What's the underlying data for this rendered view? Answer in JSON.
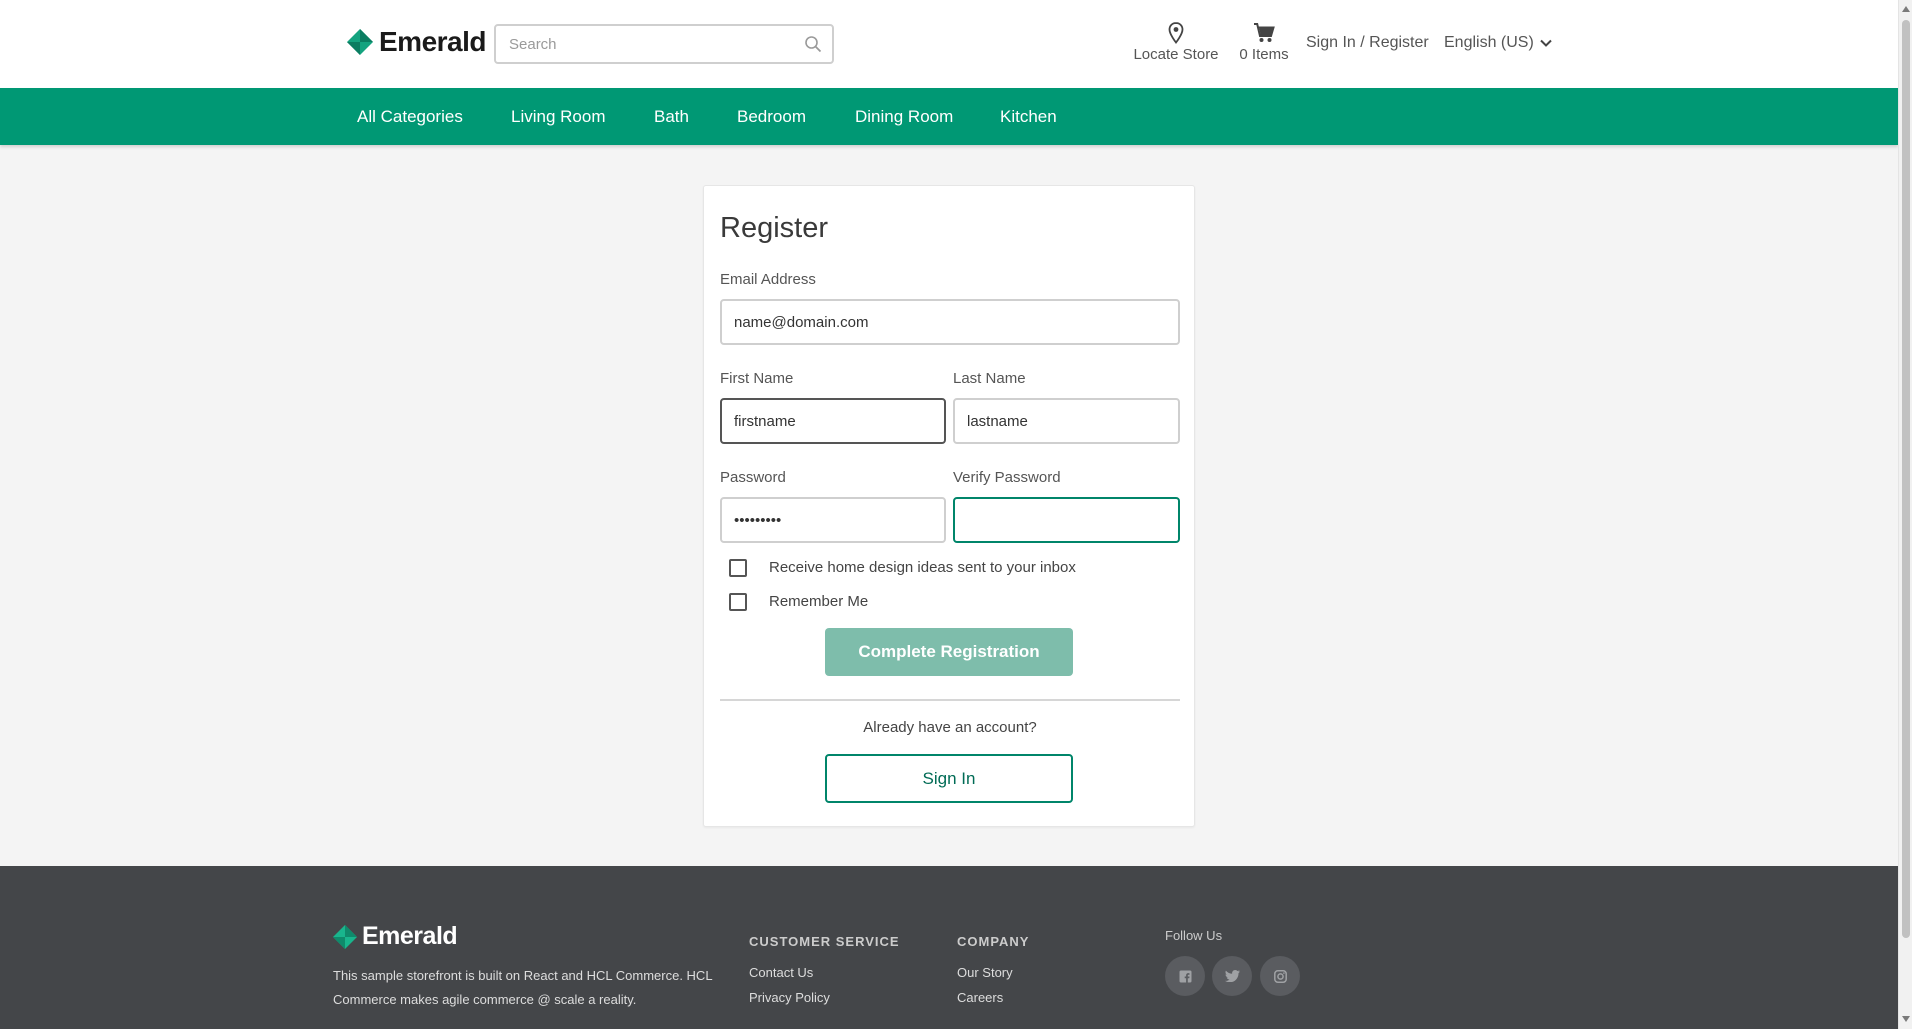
{
  "header": {
    "brand": "Emerald",
    "search_placeholder": "Search",
    "locate_store": "Locate Store",
    "cart_items": "0 Items",
    "sign_in_register": "Sign In / Register",
    "language": "English (US)"
  },
  "nav": {
    "items": [
      "All Categories",
      "Living Room",
      "Bath",
      "Bedroom",
      "Dining Room",
      "Kitchen"
    ]
  },
  "form": {
    "title": "Register",
    "email_label": "Email Address",
    "email_value": "name@domain.com",
    "first_name_label": "First Name",
    "first_name_value": "firstname",
    "last_name_label": "Last Name",
    "last_name_value": "lastname",
    "password_label": "Password",
    "password_value": "123456789",
    "verify_password_label": "Verify Password",
    "verify_password_value": "",
    "newsletter_label": "Receive home design ideas sent to your inbox",
    "remember_label": "Remember Me",
    "submit_label": "Complete Registration",
    "already_text": "Already have an account?",
    "sign_in_label": "Sign In"
  },
  "footer": {
    "brand": "Emerald",
    "description": "This sample storefront is built on React and HCL Commerce. HCL Commerce makes agile commerce @ scale a reality.",
    "customer_service_heading": "CUSTOMER SERVICE",
    "contact_us": "Contact Us",
    "privacy_policy": "Privacy Policy",
    "company_heading": "COMPANY",
    "our_story": "Our Story",
    "careers": "Careers",
    "follow_us": "Follow Us"
  },
  "colors": {
    "brand_green": "#009874",
    "button_disabled": "#7ebdab",
    "footer_bg": "#444649"
  }
}
